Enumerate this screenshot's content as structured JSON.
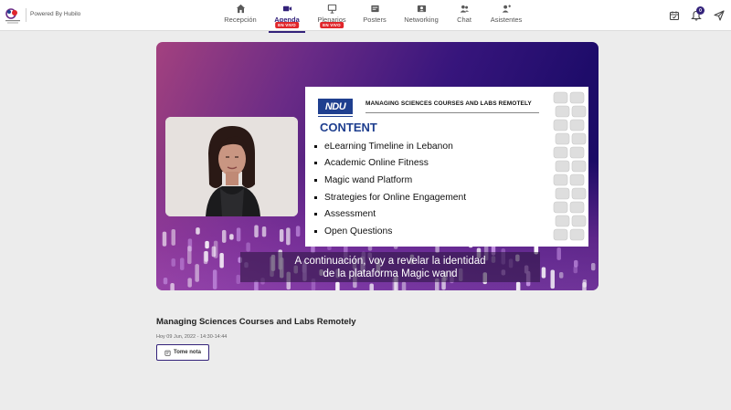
{
  "header": {
    "powered_by": "Powered By Hubilo",
    "nav": [
      {
        "label": "Recepción",
        "icon": "home-icon",
        "active": false
      },
      {
        "label": "Agenda",
        "icon": "video-camera-icon",
        "active": true,
        "badge": "EN VIVO"
      },
      {
        "label": "Plenarios",
        "icon": "presentation-icon",
        "active": false,
        "badge": "EN VIVO"
      },
      {
        "label": "Posters",
        "icon": "poster-icon",
        "active": false
      },
      {
        "label": "Networking",
        "icon": "networking-icon",
        "active": false
      },
      {
        "label": "Chat",
        "icon": "chat-icon",
        "active": false
      },
      {
        "label": "Asistentes",
        "icon": "people-icon",
        "active": false
      }
    ],
    "notification_count": "0"
  },
  "colors": {
    "primary": "#33227a",
    "live_badge": "#e0262b",
    "slide_blue": "#1f3f8f"
  },
  "video": {
    "slide": {
      "logo_text": "NDU",
      "title": "MANAGING SCIENCES COURSES AND LABS REMOTELY",
      "heading": "CONTENT",
      "items": [
        "eLearning Timeline in Lebanon",
        "Academic Online Fitness",
        "Magic wand Platform",
        "Strategies for Online Engagement",
        "Assessment",
        "Open Questions"
      ]
    },
    "caption": {
      "line1": "A continuación, voy a revelar la identidad",
      "line2": "de la plataforma Magic wand"
    }
  },
  "session": {
    "title": "Managing Sciences Courses and Labs Remotely",
    "date": "Hoy 09 Jun, 2022 - 14:30-14:44",
    "note_button": "Tome nota"
  }
}
